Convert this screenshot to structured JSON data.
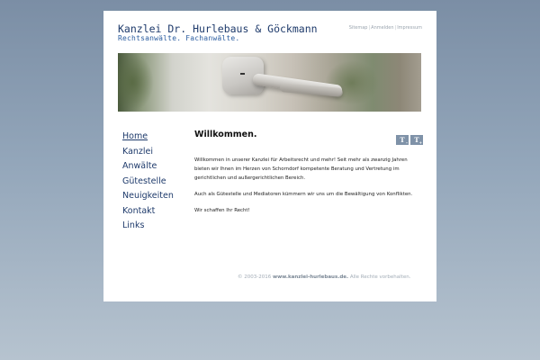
{
  "header": {
    "title": "Kanzlei Dr. Hurlebaus & Göckmann",
    "subtitle": "Rechtsanwälte. Fachanwälte."
  },
  "toplinks": [
    {
      "label": "Sitemap"
    },
    {
      "label": "Anmelden"
    },
    {
      "label": "Impressum"
    }
  ],
  "nav": {
    "items": [
      {
        "label": "Home",
        "active": true
      },
      {
        "label": "Kanzlei"
      },
      {
        "label": "Anwälte"
      },
      {
        "label": "Gütestelle"
      },
      {
        "label": "Neuigkeiten"
      },
      {
        "label": "Kontakt"
      },
      {
        "label": "Links"
      }
    ]
  },
  "content": {
    "heading": "Willkommen.",
    "paragraphs": [
      "Willkommen in unserer Kanzlei für Arbeitsrecht und mehr! Seit mehr als zwanzig Jahren bieten wir Ihnen im Herzen von Schorndorf kompetente Beratung und Vertretung im gerichtlichen und außergerichtlichen Bereich.",
      "Auch als Gütestelle und Mediatoren kümmern wir uns um die Bewältigung von Konflikten.",
      "Wir schaffen Ihr Recht!"
    ]
  },
  "fontsize_buttons": [
    {
      "glyph": "T",
      "sign": "–",
      "icon": "font-decrease-icon"
    },
    {
      "glyph": "T",
      "sign": "+",
      "icon": "font-increase-icon"
    }
  ],
  "footer": {
    "copyright": "© 2003-2016",
    "domain": "www.kanzlei-hurlebaus.de.",
    "rights": "Alle Rechte vorbehalten."
  },
  "colors": {
    "title": "#1e3a6b",
    "subtitle": "#2b5da0",
    "button_bg": "#7f92a8",
    "footer_text": "#a2acb6"
  }
}
